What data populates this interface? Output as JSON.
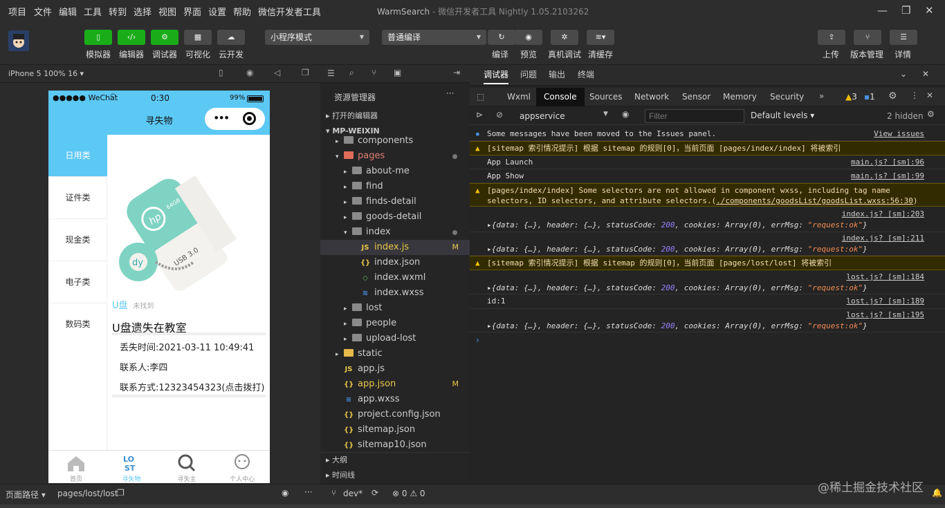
{
  "menu": [
    "项目",
    "文件",
    "编辑",
    "工具",
    "转到",
    "选择",
    "视图",
    "界面",
    "设置",
    "帮助",
    "微信开发者工具"
  ],
  "window": {
    "app": "WarmSearch",
    "suffix": "- 微信开发者工具 Nightly 1.05.2103262"
  },
  "toolbar": {
    "simulator": "模拟器",
    "editor": "编辑器",
    "debugger": "调试器",
    "visual": "可视化",
    "cloud": "云开发",
    "mode_select": "小程序模式",
    "compile_select": "普通编译",
    "compile": "编译",
    "preview": "预览",
    "realdebug": "真机调试",
    "clearcache": "清缓存",
    "upload": "上传",
    "version": "版本管理",
    "detail": "详情"
  },
  "sim": {
    "device": "iPhone 5 100% 16 ▾"
  },
  "phone": {
    "carrier": "●●●●● WeChat",
    "time": "0:30",
    "battery": "99%",
    "title": "寻失物",
    "categories": [
      "日用类",
      "证件类",
      "现金类",
      "电子类",
      "数码类"
    ],
    "item": {
      "tag": "U盘",
      "status": "未找到",
      "title": "U盘遗失在教室",
      "time": "丢失时间:2021-03-11 10:49:41",
      "contact": "联系人:李四",
      "phone": "联系方式:12323454323(点击拨打)"
    },
    "usb": {
      "brand": "hp",
      "cap": "64GB",
      "usb": "USB 3.0"
    },
    "tabs": [
      "首页",
      "寻失物",
      "寻失主",
      "个人中心"
    ]
  },
  "explorer": {
    "title": "资源管理器",
    "open_editors": "打开的编辑器",
    "project": "MP-WEIXIN",
    "rows": [
      {
        "name": "components",
        "indent": 1,
        "type": "folder"
      },
      {
        "name": "pages",
        "indent": 1,
        "type": "folder-red",
        "open": true
      },
      {
        "name": "about-me",
        "indent": 2,
        "type": "folder"
      },
      {
        "name": "find",
        "indent": 2,
        "type": "folder"
      },
      {
        "name": "finds-detail",
        "indent": 2,
        "type": "folder"
      },
      {
        "name": "goods-detail",
        "indent": 2,
        "type": "folder"
      },
      {
        "name": "index",
        "indent": 2,
        "type": "folder",
        "open": true
      },
      {
        "name": "index.js",
        "indent": 3,
        "type": "js",
        "badge": "M"
      },
      {
        "name": "index.json",
        "indent": 3,
        "type": "json"
      },
      {
        "name": "index.wxml",
        "indent": 3,
        "type": "wxml"
      },
      {
        "name": "index.wxss",
        "indent": 3,
        "type": "wxss"
      },
      {
        "name": "lost",
        "indent": 2,
        "type": "folder"
      },
      {
        "name": "people",
        "indent": 2,
        "type": "folder"
      },
      {
        "name": "upload-lost",
        "indent": 2,
        "type": "folder"
      },
      {
        "name": "static",
        "indent": 1,
        "type": "folder-yellow"
      },
      {
        "name": "app.js",
        "indent": 1,
        "type": "js"
      },
      {
        "name": "app.json",
        "indent": 1,
        "type": "json",
        "badge": "M"
      },
      {
        "name": "app.wxss",
        "indent": 1,
        "type": "wxss"
      },
      {
        "name": "project.config.json",
        "indent": 1,
        "type": "json"
      },
      {
        "name": "sitemap.json",
        "indent": 1,
        "type": "json"
      },
      {
        "name": "sitemap10.json",
        "indent": 1,
        "type": "json"
      }
    ],
    "outline": "大纲",
    "timeline": "时间线"
  },
  "devtools": {
    "top_tabs": [
      "调试器",
      "问题",
      "输出",
      "终端"
    ],
    "tabs": [
      "Wxml",
      "Console",
      "Sources",
      "Network",
      "Sensor",
      "Memory",
      "Security"
    ],
    "warn_count": "3",
    "info_count": "1",
    "context": "appservice",
    "filter_placeholder": "Filter",
    "levels": "Default levels ▾",
    "hidden": "2 hidden",
    "issues_msg": "Some messages have been moved to the Issues panel.",
    "view_issues": "View issues",
    "sitemap1": "[sitemap 索引情况提示] 根据 sitemap 的规则[0]，当前页面 [pages/index/index] 将被索引",
    "launch": "App Launch",
    "launch_src": "main.js? [sm]:96",
    "show": "App Show",
    "show_src": "main.js? [sm]:99",
    "sel_warn1": "[pages/index/index] Some selectors are not allowed in component wxss, including tag name",
    "sel_warn2a": "selectors, ID selectors, and attribute selectors.(",
    "sel_warn2b": "./components/goodsList/goodsList.wxss:56:30",
    "sel_warn2c": ")",
    "src203": "index.js? [sm]:203",
    "src211": "index.js? [sm]:211",
    "sitemap2": "[sitemap 索引情况提示] 根据 sitemap 的规则[0]，当前页面 [pages/lost/lost] 将被索引",
    "src184": "lost.js? [sm]:184",
    "id": "id:1",
    "src189": "lost.js? [sm]:189",
    "src195": "lost.js? [sm]:195",
    "obj_a": "▸{data: {…}, header: {…}, statusCode: ",
    "obj_code": "200",
    "obj_b": ", cookies: Array(0), errMsg: ",
    "obj_msg": "\"request:ok\"",
    "obj_c": "}"
  },
  "status": {
    "path_label": "页面路径 ▾",
    "path": "pages/lost/lost",
    "branch": "dev*",
    "errors": "⊗ 0 ⚠ 0",
    "watermark": "@稀土掘金技术社区"
  }
}
